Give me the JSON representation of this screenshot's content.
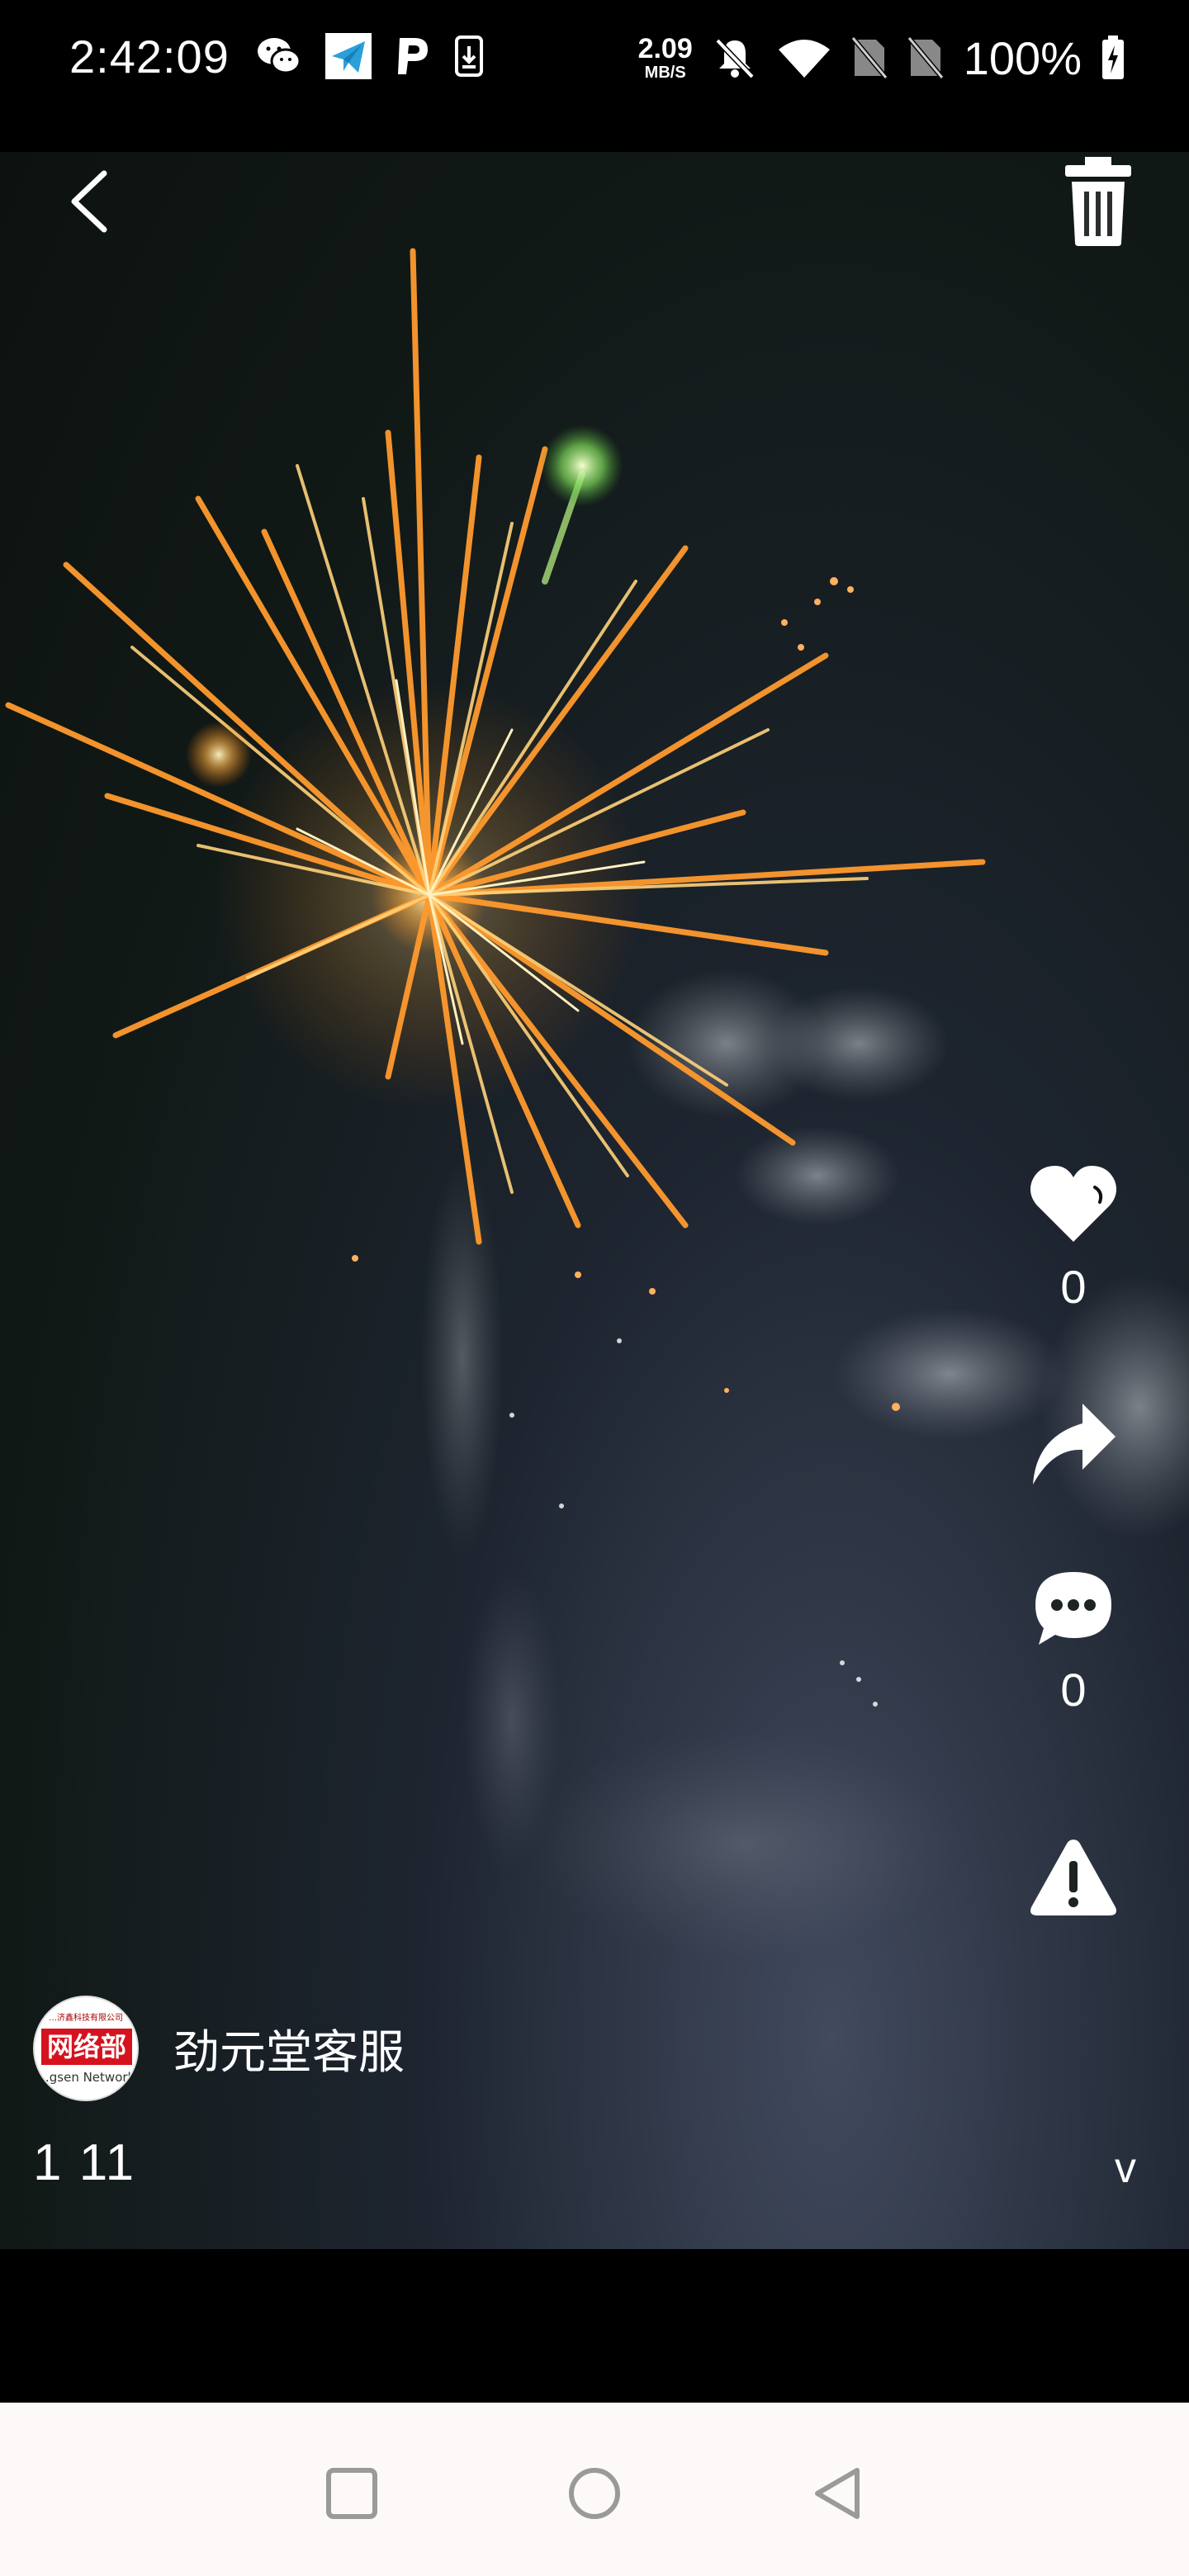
{
  "status_bar": {
    "time": "2:42:09",
    "net_speed_value": "2.09",
    "net_speed_unit": "MB/S",
    "battery_percent": "100%",
    "left_icons": [
      "wechat-icon",
      "telegram-icon",
      "parking-p-icon",
      "download-icon"
    ],
    "right_icons": [
      "mute-bell-icon",
      "wifi-icon",
      "no-sim-icon",
      "no-sim-icon",
      "battery-charging-icon"
    ]
  },
  "video": {
    "like_count": "0",
    "comment_count": "0",
    "author": {
      "name": "劲元堂客服",
      "avatar_badge_text": "网络部",
      "avatar_top_text": "…济鑫科技有限公司",
      "avatar_bottom_text": "…gsen Network"
    },
    "caption": "1 11",
    "expand_label": "v"
  },
  "nav_bar": {
    "buttons": [
      "recent-apps",
      "home",
      "back"
    ]
  },
  "colors": {
    "icon": "#ffffff",
    "nav_background": "#fdf9f8",
    "nav_icon": "#9a9a9a",
    "avatar_badge": "#d6121f"
  }
}
